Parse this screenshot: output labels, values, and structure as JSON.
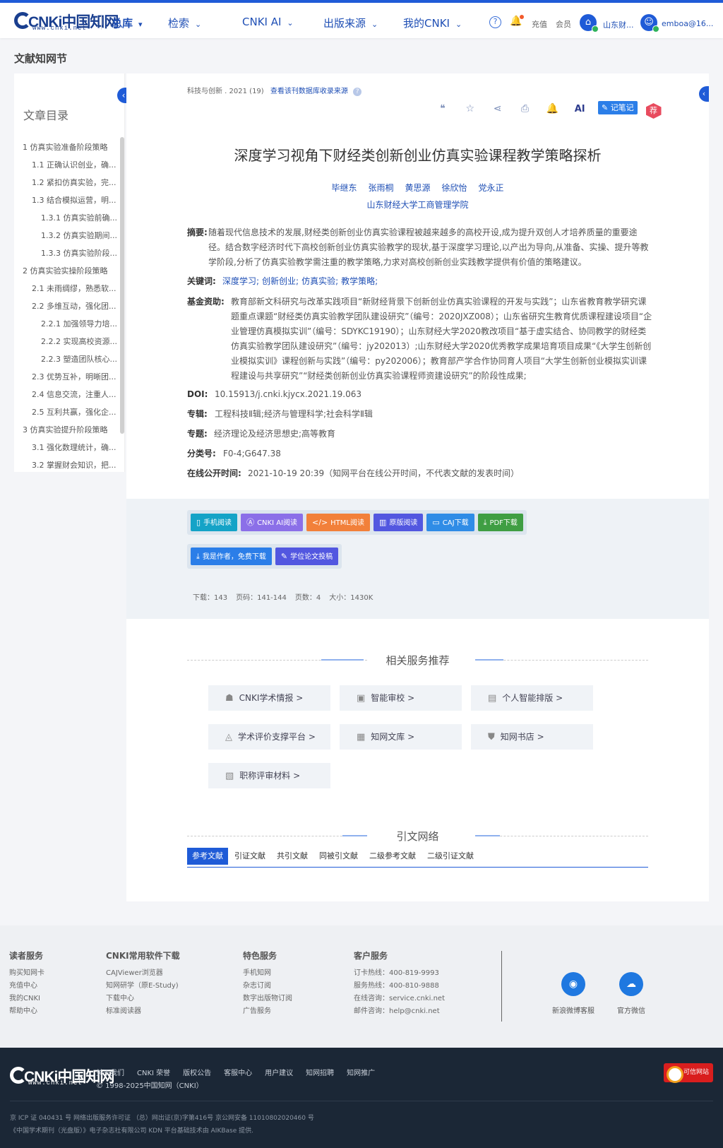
{
  "header": {
    "logo_text": "CNKi中国知网",
    "logo_sub": "www.cnki.net",
    "nav": [
      {
        "label": "总库"
      },
      {
        "label": "检索"
      },
      {
        "label": "CNKI AI"
      },
      {
        "label": "出版来源"
      },
      {
        "label": "我的CNKI"
      }
    ],
    "help_glyph": "?",
    "recharge": "充值",
    "member": "会员",
    "institution": "山东财...",
    "user": "emboa@16..."
  },
  "page_title": "文献知网节",
  "toc": {
    "title": "文章目录",
    "items": [
      {
        "label": "1 仿真实验准备阶段策略",
        "level": 1
      },
      {
        "label": "1.1 正确认识创业，确...",
        "level": 2
      },
      {
        "label": "1.2 紧扣仿真实验，完...",
        "level": 2
      },
      {
        "label": "1.3 结合模拟运营，明...",
        "level": 2
      },
      {
        "label": "1.3.1 仿真实验前确...",
        "level": 3
      },
      {
        "label": "1.3.2 仿真实验期间...",
        "level": 3
      },
      {
        "label": "1.3.3 仿真实验阶段...",
        "level": 3
      },
      {
        "label": "2 仿真实验实操阶段策略",
        "level": 1
      },
      {
        "label": "2.1 未雨绸缪，熟悉软...",
        "level": 2
      },
      {
        "label": "2.2 多维互动，强化团...",
        "level": 2
      },
      {
        "label": "2.2.1 加强领导力培...",
        "level": 3
      },
      {
        "label": "2.2.2 实现高校资源...",
        "level": 3
      },
      {
        "label": "2.2.3 塑造团队核心...",
        "level": 3
      },
      {
        "label": "2.3 优势互补，明晰团...",
        "level": 2
      },
      {
        "label": "2.4 信息交流，注重人...",
        "level": 2
      },
      {
        "label": "2.5 互利共赢，强化企...",
        "level": 2
      },
      {
        "label": "3 仿真实验提升阶段策略",
        "level": 1
      },
      {
        "label": "3.1 强化数理统计，确...",
        "level": 2
      },
      {
        "label": "3.2 掌握财会知识，把...",
        "level": 2
      }
    ]
  },
  "article": {
    "source": "科技与创新 . 2021 (19)",
    "source_link": "查看该刊数据库收录来源",
    "tools": {
      "note": "记笔记",
      "recommend": "荐",
      "ai": "AI"
    },
    "title": "深度学习视角下财经类创新创业仿真实验课程教学策略探析",
    "authors": [
      "毕继东",
      "张雨桐",
      "黄思源",
      "徐欣怡",
      "党永正"
    ],
    "institution": "山东财经大学工商管理学院",
    "abstract_label": "摘要:",
    "abstract": "随着现代信息技术的发展,财经类创新创业仿真实验课程被越来越多的高校开设,成为提升双创人才培养质量的重要途径。结合数字经济时代下高校创新创业仿真实验教学的现状,基于深度学习理论,以产出为导向,从准备、实操、提升等教学阶段,分析了仿真实验教学需注重的教学策略,力求对高校创新创业实践教学提供有价值的策略建议。",
    "keywords_label": "关键词:",
    "keywords": [
      "深度学习;",
      "创新创业;",
      "仿真实验;",
      "教学策略;"
    ],
    "fund_label": "基金资助:",
    "fund": "教育部新文科研究与改革实践项目“新财经背景下创新创业仿真实验课程的开发与实践”；山东省教育教学研究课题重点课题“财经类仿真实验教学团队建设研究”（编号：2020JXZ008）；山东省研究生教育优质课程建设项目“企业管理仿真模拟实训”（编号：SDYKC19190）；山东财经大学2020教改项目“基于虚实结合、协同教学的财经类仿真实验教学团队建设研究”（编号：jy202013）;山东财经大学2020优秀教学成果培育项目成果“《大学生创新创业模拟实训》课程创新与实践”（编号：py202006）；教育部产学合作协同育人项目“大学生创新创业模拟实训课程建设与共享研究”“财经类创新创业仿真实验课程师资建设研究”的阶段性成果;",
    "doi_label": "DOI:",
    "doi": "10.15913/j.cnki.kjycx.2021.19.063",
    "series_label": "专辑:",
    "series": "工程科技Ⅱ辑;经济与管理科学;社会科学Ⅱ辑",
    "topic_label": "专题:",
    "topic": "经济理论及经济思想史;高等教育",
    "class_label": "分类号:",
    "class_no": "F0-4;G647.38",
    "online_label": "在线公开时间:",
    "online": "2021-10-19 20:39（知网平台在线公开时间，不代表文献的发表时间）"
  },
  "downloads": {
    "buttons": [
      {
        "label": "手机阅读",
        "color": "#14a3c7"
      },
      {
        "label": "CNKI AI阅读",
        "color": "#8b6fe8"
      },
      {
        "label": "HTML阅读",
        "color": "#f2803a"
      },
      {
        "label": "原版阅读",
        "color": "#5257e0"
      },
      {
        "label": "CAJ下载",
        "color": "#2f8ce6"
      },
      {
        "label": "PDF下载",
        "color": "#3f9e43"
      }
    ],
    "buttons2": [
      {
        "label": "我是作者，免费下载",
        "color": "#2b7ee8"
      },
      {
        "label": "学位论文投稿",
        "color": "#5257e0"
      }
    ],
    "stats": [
      "下载：143",
      "页码：141-144",
      "页数：4",
      "大小：1430K"
    ]
  },
  "services": {
    "title": "相关服务推荐",
    "items": [
      "CNKI学术情报 >",
      "智能审校 >",
      "个人智能排版 >",
      "学术评价支撑平台 >",
      "知网文库 >",
      "知网书店 >",
      "职称评审材料 >"
    ]
  },
  "citation": {
    "title": "引文网络",
    "tabs": [
      "参考文献",
      "引证文献",
      "共引文献",
      "同被引文献",
      "二级参考文献",
      "二级引证文献"
    ]
  },
  "footer": {
    "cols": [
      {
        "title": "读者服务",
        "items": [
          "购买知网卡",
          "充值中心",
          "我的CNKI",
          "帮助中心"
        ]
      },
      {
        "title": "CNKI常用软件下载",
        "items": [
          "CAJViewer浏览器",
          "知网研学（原E-Study)",
          "下载中心",
          "标准阅读器"
        ]
      },
      {
        "title": "特色服务",
        "items": [
          "手机知网",
          "杂志订阅",
          "数字出版物订阅",
          "广告服务"
        ]
      },
      {
        "title": "客户服务",
        "items": [
          "订卡热线：400-819-9993",
          "服务热线：400-810-9888",
          "在线咨询：service.cnki.net",
          "邮件咨询：help@cnki.net"
        ]
      }
    ],
    "social": [
      "新浪微博客服",
      "官方微信"
    ],
    "links": [
      "关于我们",
      "CNKI 荣誉",
      "版权公告",
      "客服中心",
      "用户建议",
      "知网招聘",
      "知网推广"
    ],
    "copyright": "© 1998-2025中国知网（CNKI）",
    "icp1": "京 ICP 证 040431 号  网络出版服务许可证 （总）网出证(京)字第416号  京公网安备 11010802020460 号",
    "icp2": "《中国学术期刊（光盘版）》电子杂志社有限公司  KDN 平台基础技术由 AIKBase 提供.",
    "badge": "可信网站"
  }
}
